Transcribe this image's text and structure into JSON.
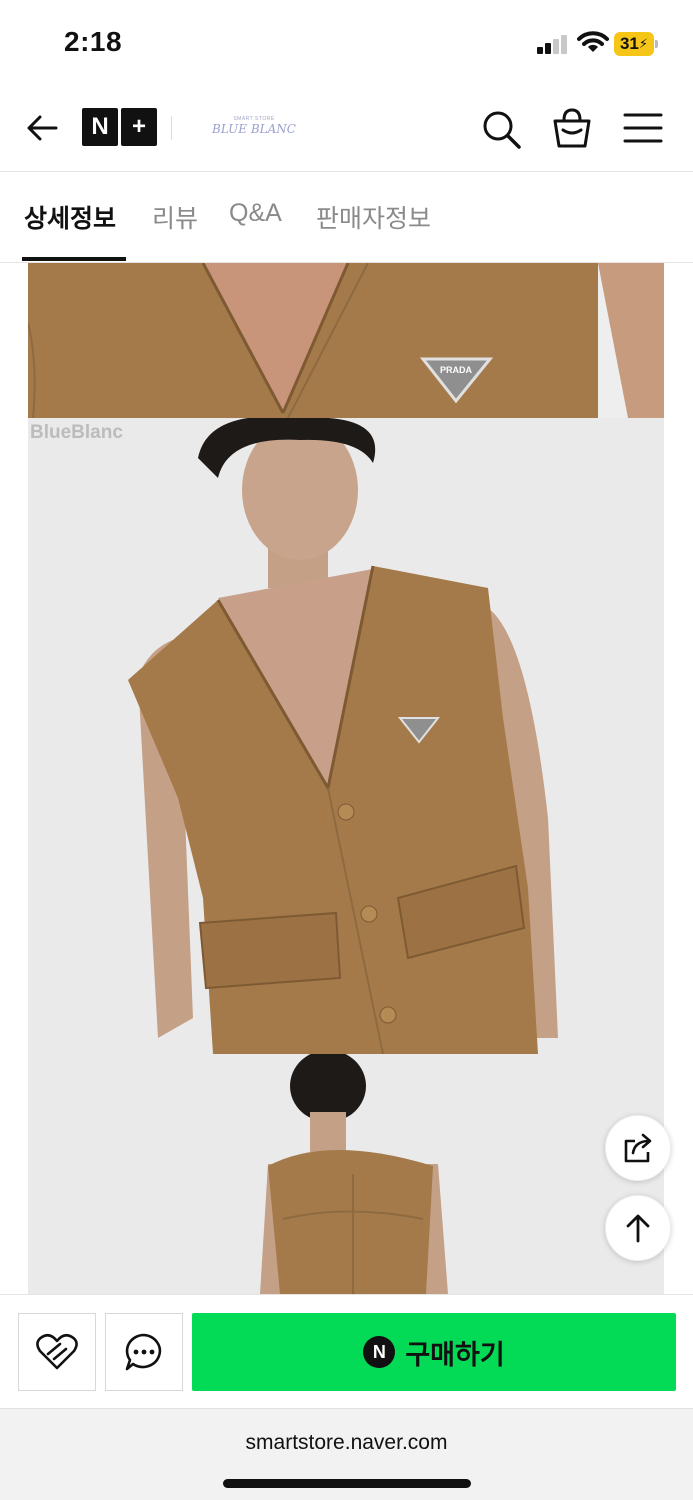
{
  "status_bar": {
    "time": "2:18",
    "battery": "31"
  },
  "header": {
    "nplus": {
      "n": "N",
      "plus": "+"
    },
    "store_logo": {
      "small": "SMART STORE",
      "main": "BLUE BLANC"
    }
  },
  "tabs": [
    {
      "label": "상세정보",
      "active": true
    },
    {
      "label": "리뷰",
      "active": false
    },
    {
      "label": "Q&A",
      "active": false
    },
    {
      "label": "판매자정보",
      "active": false
    }
  ],
  "product_images": {
    "brand_plaque": "PRADA",
    "watermark": "BlueBlanc",
    "jacket_color": "#a57a4a",
    "background_color": "#eaeaeb"
  },
  "floating_buttons": [
    "share-icon",
    "arrow-up-icon"
  ],
  "action_bar": {
    "buy_badge": "N",
    "buy_label": "구매하기",
    "buy_color": "#03da55"
  },
  "browser": {
    "url": "smartstore.naver.com"
  }
}
